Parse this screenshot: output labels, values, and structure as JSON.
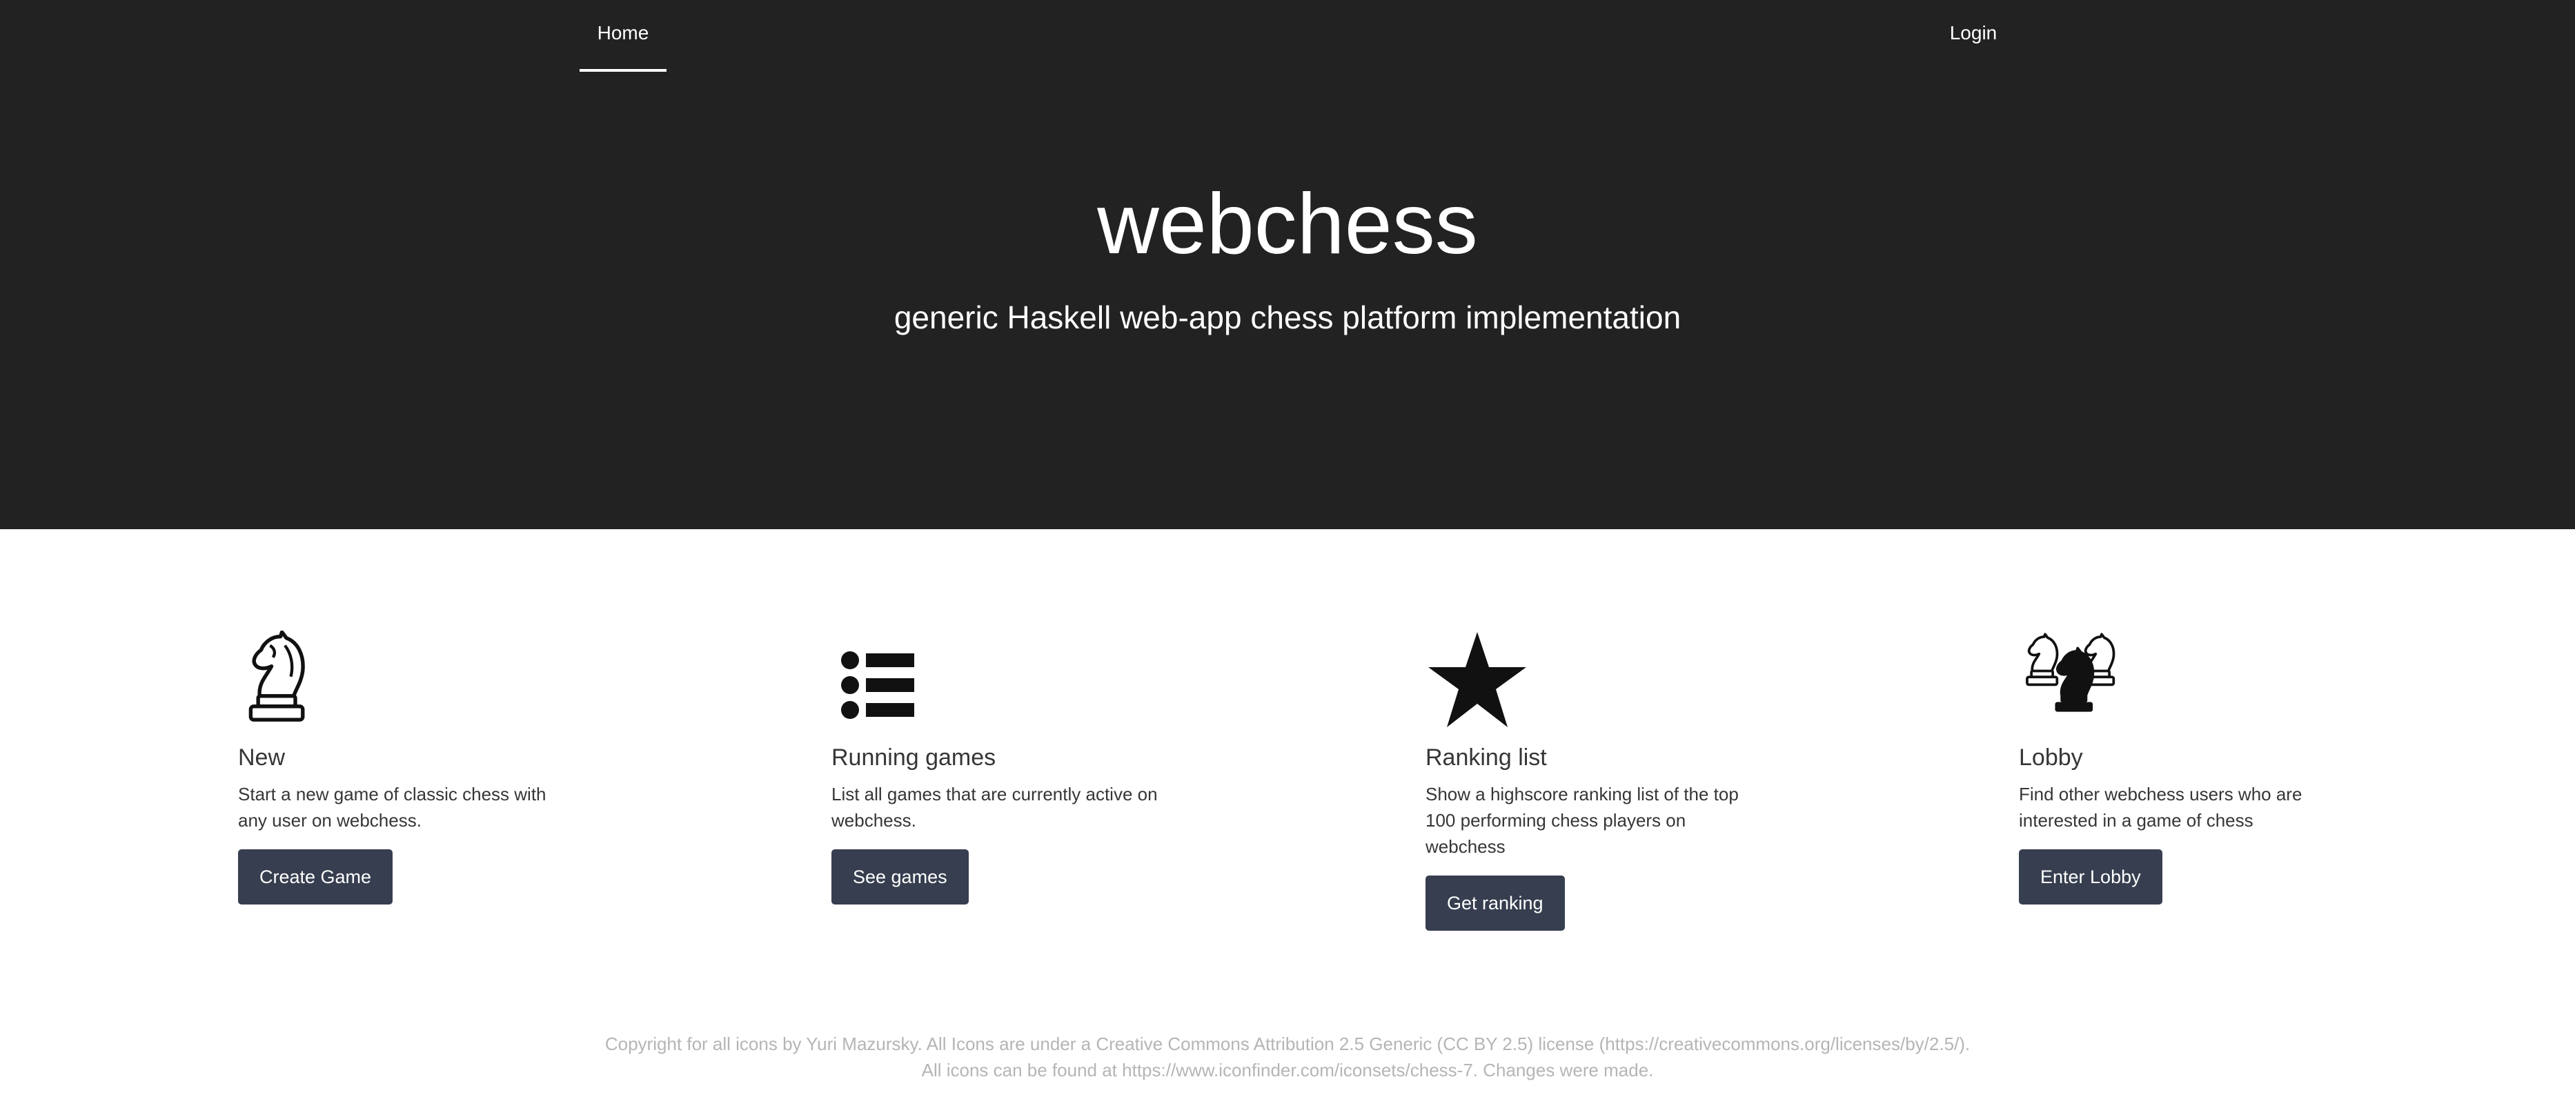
{
  "nav": {
    "home_label": "Home",
    "login_label": "Login"
  },
  "hero": {
    "title": "webchess",
    "subtitle": "generic Haskell web-app chess platform implementation"
  },
  "features": [
    {
      "icon": "knight-icon",
      "title": "New",
      "description": "Start a new game of classic chess with any user on webchess.",
      "button_label": "Create Game"
    },
    {
      "icon": "list-icon",
      "title": "Running games",
      "description": "List all games that are currently active on webchess.",
      "button_label": "See games"
    },
    {
      "icon": "star-icon",
      "title": "Ranking list",
      "description": "Show a highscore ranking list of the top 100 performing chess players on webchess",
      "button_label": "Get ranking"
    },
    {
      "icon": "knights-group-icon",
      "title": "Lobby",
      "description": "Find other webchess users who are interested in a game of chess",
      "button_label": "Enter Lobby"
    }
  ],
  "footer": {
    "line1": "Copyright for all icons by Yuri Mazursky. All Icons are under a Creative Commons Attribution 2.5 Generic (CC BY 2.5) license (https://creativecommons.org/licenses/by/2.5/).",
    "line2": "All icons can be found at https://www.iconfinder.com/iconsets/chess-7. Changes were made."
  },
  "colors": {
    "hero_background": "#222222",
    "button_background": "#363e4f",
    "footer_text": "#b5b5b5"
  }
}
